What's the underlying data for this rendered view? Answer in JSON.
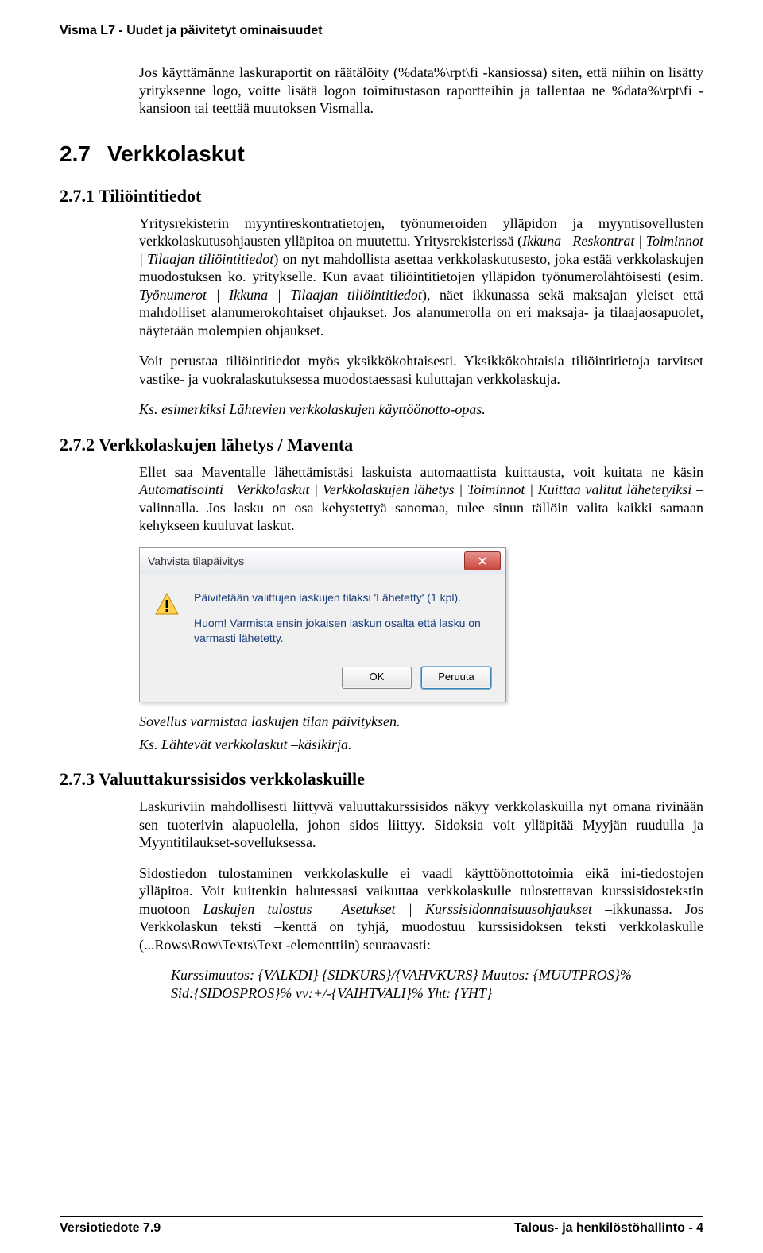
{
  "header": {
    "title": "Visma L7 - Uudet ja päivitetyt ominaisuudet"
  },
  "intro": {
    "p1": "Jos käyttämänne laskuraportit on räätälöity (%data%\\rpt\\fi -kansiossa) siten, että niihin on lisätty yrityksenne logo, voitte lisätä logon toimitustason raportteihin ja tallentaa ne %data%\\rpt\\fi -kansioon tai teettää muutoksen Vismalla."
  },
  "sec27": {
    "number": "2.7",
    "title": "Verkkolaskut"
  },
  "s271": {
    "heading": "2.7.1  Tiliöintitiedot",
    "p1_a": "Yritysrekisterin myyntireskontratietojen, työnumeroiden ylläpidon ja myyntisovellusten verkkolaskutusohjausten ylläpitoa on muutettu. Yritysrekisterissä (",
    "p1_b": "Ikkuna | Reskontrat | Toiminnot | Tilaajan tiliöintitiedot",
    "p1_c": ") on nyt mahdollista asettaa verkkolaskutusesto, joka estää verkkolaskujen muodostuksen ko. yritykselle. Kun avaat tiliöintitietojen ylläpidon työnumerolähtöisesti (esim. ",
    "p1_d": "Työnumerot | Ikkuna | Tilaajan tiliöintitiedot",
    "p1_e": "), näet ikkunassa sekä maksajan yleiset että mahdolliset alanumerokohtaiset ohjaukset. Jos alanumerolla on eri maksaja- ja tilaajaosapuolet, näytetään molempien ohjaukset.",
    "p2": "Voit perustaa tiliöintitiedot myös yksikkökohtaisesti. Yksikkökohtaisia tiliöintitietoja tarvitset vastike- ja vuokralaskutuksessa muodostaessasi kuluttajan verkkolaskuja.",
    "p3": "Ks. esimerkiksi Lähtevien verkkolaskujen käyttöönotto-opas."
  },
  "s272": {
    "heading": "2.7.2  Verkkolaskujen lähetys / Maventa",
    "p1_a": "Ellet saa Maventalle lähettämistäsi laskuista automaattista kuittausta, voit kuitata ne käsin ",
    "p1_b": "Automatisointi | Verkkolaskut | Verkkolaskujen lähetys | Toiminnot | Kuittaa valitut lähetetyiksi",
    "p1_c": " –valinnalla. Jos lasku on osa kehystettyä sanomaa, tulee sinun tällöin valita kaikki samaan kehykseen kuuluvat laskut.",
    "dialog": {
      "title": "Vahvista tilapäivitys",
      "msg1": "Päivitetään valittujen laskujen tilaksi 'Lähetetty' (1 kpl).",
      "msg2": "Huom! Varmista ensin jokaisen laskun osalta että lasku on varmasti lähetetty.",
      "ok": "OK",
      "cancel": "Peruuta"
    },
    "caption": "Sovellus varmistaa laskujen tilan päivityksen.",
    "ref": "Ks. Lähtevät verkkolaskut –käsikirja."
  },
  "s273": {
    "heading": "2.7.3  Valuuttakurssisidos verkkolaskuille",
    "p1": "Laskuriviin mahdollisesti liittyvä valuuttakurssisidos näkyy verkkolaskuilla nyt omana rivinään sen tuoterivin alapuolella, johon sidos liittyy. Sidoksia voit ylläpitää Myyjän ruudulla ja Myyntitilaukset-sovelluksessa.",
    "p2_a": "Sidostiedon tulostaminen verkkolaskulle ei vaadi käyttöönottotoimia eikä ini-tiedostojen ylläpitoa. Voit kuitenkin halutessasi vaikuttaa verkkolaskulle tulostettavan kurssisidostekstin muotoon ",
    "p2_b": "Laskujen tulostus | Asetukset | Kurssisidonnaisuusohjaukset",
    "p2_c": " –ikkunassa. Jos Verkkolaskun teksti –kenttä on tyhjä, muodostuu kurssisidoksen teksti verkkolaskulle (...Rows\\Row\\Texts\\Text -elementtiin) seuraavasti:",
    "code1": "Kurssimuutos: {VALKDI} {SIDKURS}/{VAHVKURS} Muutos: {MUUTPROS}%",
    "code2": "Sid:{SIDOSPROS}% vv:+/-{VAIHTVALI}% Yht: {YHT}"
  },
  "footer": {
    "left": "Versiotiedote 7.9",
    "right": "Talous- ja henkilöstöhallinto - 4"
  }
}
